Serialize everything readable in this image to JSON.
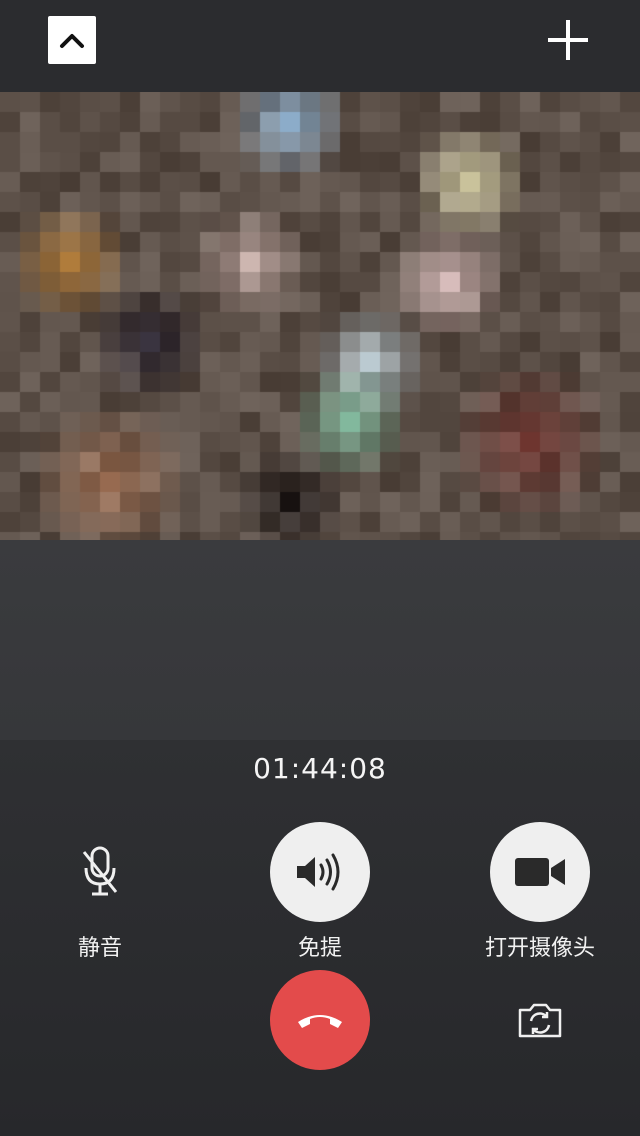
{
  "call": {
    "duration": "01:44:08"
  },
  "controls": {
    "mute": {
      "label": "静音",
      "icon": "microphone-off-icon"
    },
    "speaker": {
      "label": "免提",
      "icon": "speaker-icon"
    },
    "camera": {
      "label": "打开摄像头",
      "icon": "video-camera-icon"
    }
  },
  "actions": {
    "collapse_icon": "chevron-up-icon",
    "add_icon": "plus-icon",
    "hangup_icon": "phone-hangup-icon",
    "flip_camera_icon": "camera-switch-icon"
  },
  "colors": {
    "background": "#2b2c2f",
    "hangup": "#e34b4b",
    "button_light": "#efefef"
  }
}
